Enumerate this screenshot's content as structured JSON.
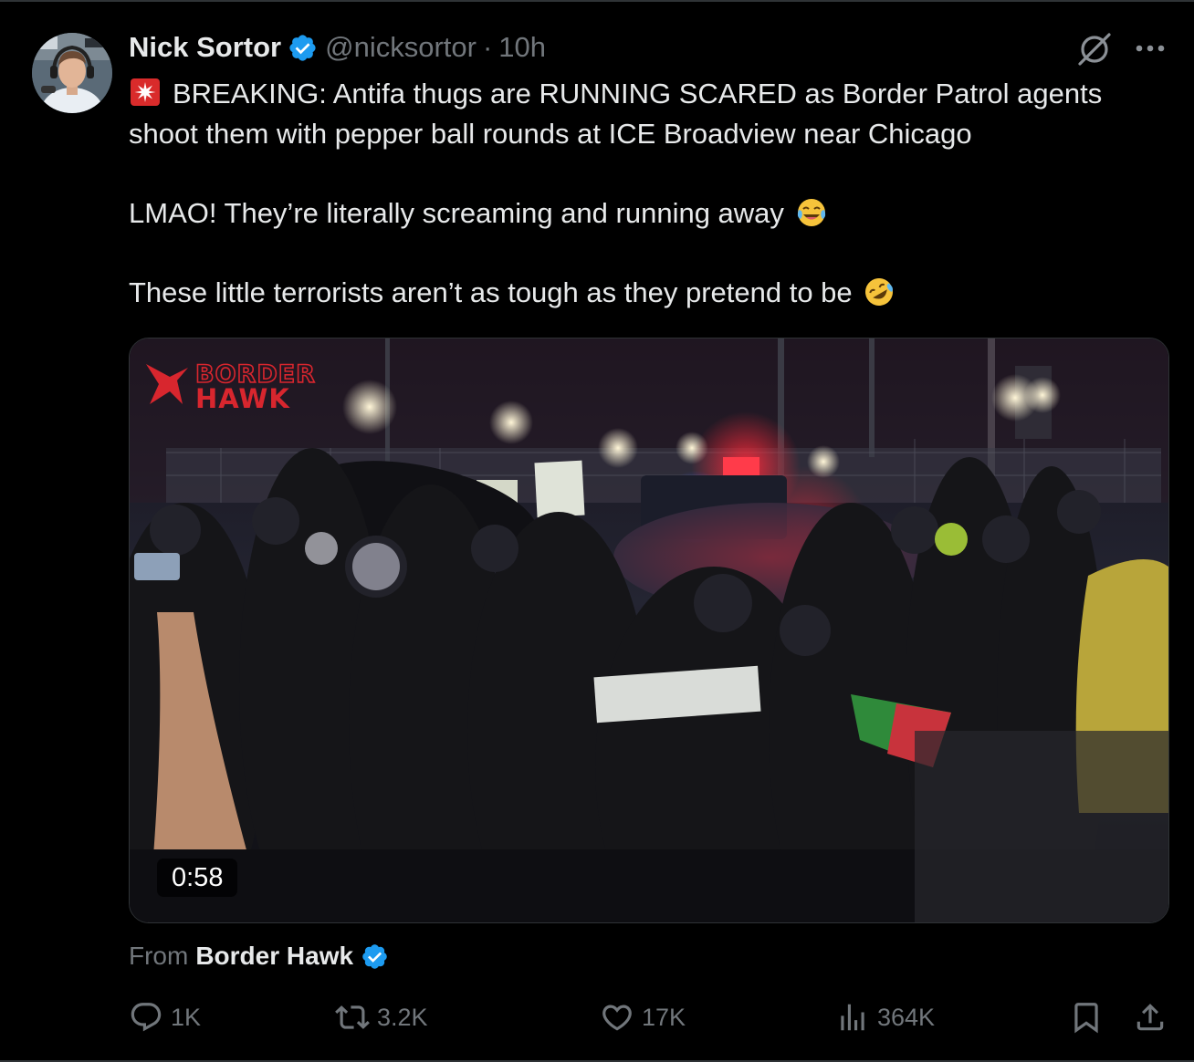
{
  "tweet": {
    "author_name": "Nick Sortor",
    "handle": "@nicksortor",
    "separator": "·",
    "time": "10h",
    "verified": true,
    "text_lines": [
      "BREAKING: Antifa thugs are RUNNING SCARED as Border Patrol agents shoot them with pepper ball rounds at ICE Broadview near Chicago",
      "LMAO! They’re literally screaming and running away",
      "These little terrorists aren’t as tough as they pretend to be"
    ],
    "emojis": [
      "rotating-light-icon",
      "face-with-tears-of-joy-icon",
      "rolling-on-floor-laughing-icon"
    ]
  },
  "media": {
    "watermark_text": "BORDER HAWK",
    "duration": "0:58",
    "source_label": "From",
    "source_name": "Border Hawk",
    "source_verified": true
  },
  "actions": {
    "reply_count": "1K",
    "repost_count": "3.2K",
    "like_count": "17K",
    "views_count": "364K"
  },
  "colors": {
    "background": "#000000",
    "text_primary": "#e7e9ea",
    "text_secondary": "#71767b",
    "verified_blue": "#1d9bf0",
    "watermark_red": "#d8262e"
  }
}
